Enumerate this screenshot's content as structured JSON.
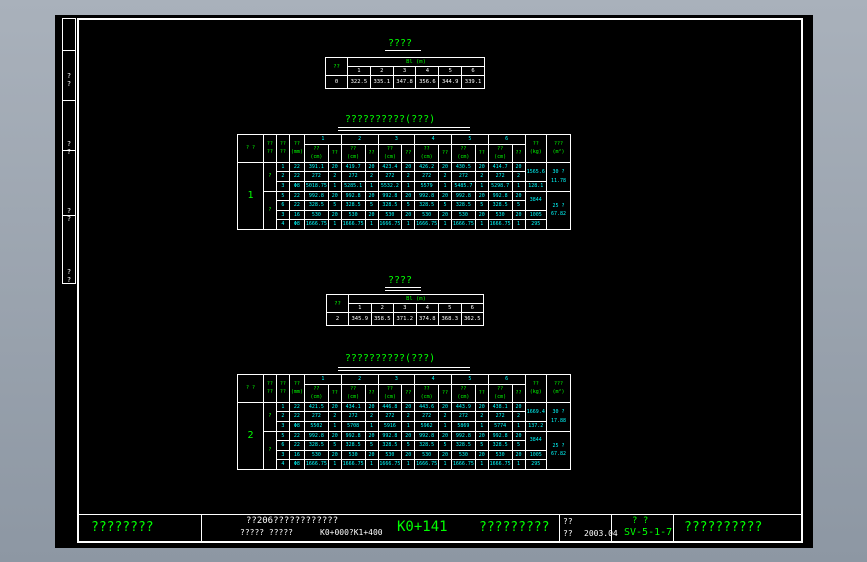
{
  "binding_strip": {
    "labels": [
      "? ?",
      "? ?",
      "? ?",
      "? ?"
    ]
  },
  "section1": {
    "summary_title": "????",
    "summary": {
      "h1": "??",
      "group": "Bl (m)",
      "cols": [
        "1",
        "2",
        "3",
        "4",
        "5",
        "6"
      ],
      "row_label": "0",
      "values": [
        "322.5",
        "335.1",
        "347.8",
        "356.6",
        "344.9",
        "339.1"
      ]
    },
    "main_title": "??????????(???)",
    "pier_no": "1",
    "headers": {
      "h1": "? ?",
      "h2a": "??",
      "h2b": "??",
      "h3a": "??",
      "h3b": "??",
      "h4a": "??",
      "h4b": "(mm)",
      "groups": [
        "1",
        "2",
        "3",
        "4",
        "5",
        "6"
      ],
      "sub_a": "??",
      "sub_b": "??",
      "sub_unit": "(cm)",
      "tail1": "??",
      "tail1_unit": "(kg)",
      "tail2": "???",
      "tail2_unit": "(m²)"
    },
    "block_labels": [
      "?",
      "?"
    ],
    "rows": [
      {
        "no": "1",
        "d": "22",
        "v": [
          "391.1",
          "20",
          "419.7",
          "20",
          "423.4",
          "20",
          "426.2",
          "20",
          "430.5",
          "20",
          "414.7",
          "20"
        ]
      },
      {
        "no": "2",
        "d": "22",
        "v": [
          "272",
          "2",
          "272",
          "2",
          "272",
          "2",
          "272",
          "2",
          "272",
          "2",
          "272",
          "2"
        ]
      },
      {
        "no": "3",
        "d": "Φ8",
        "v": [
          "5018.75",
          "1",
          "5285.1",
          "1",
          "5532.2",
          "1",
          "5579",
          "1",
          "5485.7",
          "1",
          "5298.7",
          "1"
        ]
      },
      {
        "no": "5",
        "d": "22",
        "v": [
          "992.8",
          "20",
          "992.8",
          "20",
          "992.8",
          "20",
          "992.8",
          "20",
          "992.8",
          "20",
          "992.8",
          "20"
        ]
      },
      {
        "no": "6",
        "d": "22",
        "v": [
          "328.5",
          "5",
          "328.5",
          "5",
          "328.5",
          "5",
          "328.5",
          "5",
          "328.5",
          "5",
          "328.5",
          "5"
        ]
      },
      {
        "no": "3",
        "d": "16",
        "v": [
          "530",
          "20",
          "530",
          "20",
          "530",
          "20",
          "530",
          "20",
          "530",
          "20",
          "530",
          "20"
        ]
      },
      {
        "no": "4",
        "d": "Φ8",
        "v": [
          "1666.75",
          "1",
          "1666.75",
          "1",
          "1666.75",
          "1",
          "1666.75",
          "1",
          "1666.75",
          "1",
          "1666.75",
          "1"
        ]
      }
    ],
    "weights": [
      "1565.6",
      "128.1",
      "3844",
      "1005",
      "295"
    ],
    "areas": [
      "30 ?",
      "11.78",
      "25 ?",
      "67.82"
    ]
  },
  "section2": {
    "summary_title": "????",
    "summary": {
      "h1": "??",
      "group": "Bl (m)",
      "cols": [
        "1",
        "2",
        "3",
        "4",
        "5",
        "6"
      ],
      "row_label": "2",
      "values": [
        "345.9",
        "358.5",
        "371.2",
        "374.8",
        "368.3",
        "362.5"
      ]
    },
    "main_title": "??????????(???)",
    "pier_no": "2",
    "block_labels": [
      "?",
      "?"
    ],
    "rows": [
      {
        "no": "1",
        "d": "22",
        "v": [
          "421.5",
          "20",
          "434.1",
          "20",
          "446.8",
          "20",
          "443.6",
          "20",
          "443.9",
          "20",
          "438.1",
          "20"
        ]
      },
      {
        "no": "2",
        "d": "22",
        "v": [
          "272",
          "2",
          "272",
          "2",
          "272",
          "2",
          "272",
          "2",
          "272",
          "2",
          "272",
          "2"
        ]
      },
      {
        "no": "3",
        "d": "Φ8",
        "v": [
          "5502",
          "1",
          "5708",
          "1",
          "5916",
          "1",
          "5962",
          "1",
          "5869",
          "1",
          "5774",
          "1"
        ]
      },
      {
        "no": "5",
        "d": "22",
        "v": [
          "992.8",
          "20",
          "992.8",
          "20",
          "992.8",
          "20",
          "992.8",
          "20",
          "992.8",
          "20",
          "992.8",
          "20"
        ]
      },
      {
        "no": "6",
        "d": "22",
        "v": [
          "328.5",
          "5",
          "328.5",
          "5",
          "328.5",
          "5",
          "328.5",
          "5",
          "328.5",
          "5",
          "328.5",
          "5"
        ]
      },
      {
        "no": "3",
        "d": "16",
        "v": [
          "530",
          "20",
          "530",
          "20",
          "530",
          "20",
          "530",
          "20",
          "530",
          "20",
          "530",
          "20"
        ]
      },
      {
        "no": "4",
        "d": "Φ8",
        "v": [
          "1666.75",
          "1",
          "1666.75",
          "1",
          "1666.75",
          "1",
          "1666.75",
          "1",
          "1666.75",
          "1",
          "1666.75",
          "1"
        ]
      }
    ],
    "weights": [
      "1669.4",
      "137.2",
      "3844",
      "1005",
      "295"
    ],
    "areas": [
      "30 ?",
      "17.88",
      "25 ?",
      "67.82"
    ]
  },
  "title_block": {
    "designer": "????????",
    "project_line1": "??206????????????",
    "project_line2a": "?????   ?????",
    "project_line2b": "K0+000?K1+400",
    "station": "K0+141",
    "drawing_name": "?????????",
    "date_label1": "??",
    "date_label2": "??",
    "date": "2003.04",
    "code_label": "? ?",
    "code": "SV-5-1-7",
    "company": "??????????"
  }
}
